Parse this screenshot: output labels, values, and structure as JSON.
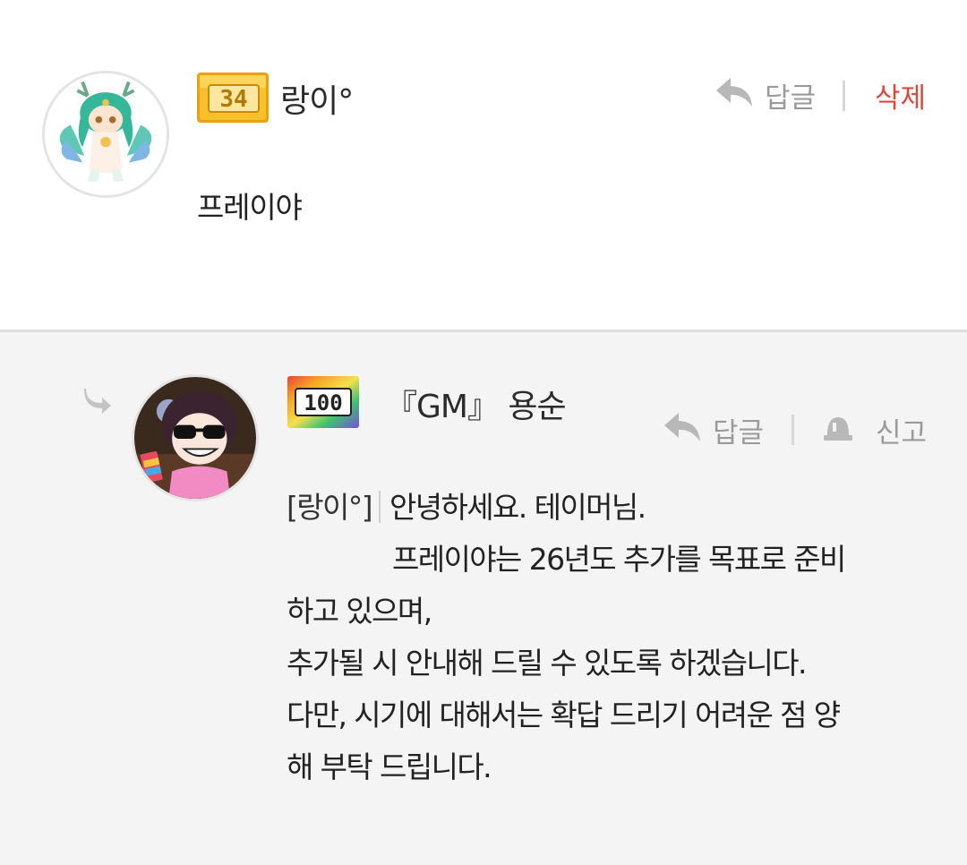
{
  "comment": {
    "level": "34",
    "username": "랑이°",
    "reply_label": "답글",
    "delete_label": "삭제",
    "text": "프레이야"
  },
  "reply": {
    "level": "100",
    "username": "『GM』 용순",
    "reply_label": "답글",
    "report_label": "신고",
    "mention": "[랑이°]",
    "lines": [
      "안녕하세요. 테이머님.",
      "프레이야는 26년도 추가를 목표로 준비",
      "하고 있으며,",
      "추가될 시 안내해 드릴 수 있도록 하겠습니다.",
      "다만, 시기에 대해서는 확답 드리기 어려운 점 양",
      "해 부탁 드립니다."
    ]
  },
  "icons": {
    "reply": "reply-arrow-icon",
    "report": "siren-icon",
    "thread": "thread-reply-icon"
  },
  "colors": {
    "delete": "#d94a3e",
    "action": "#9a9a9a",
    "reply_bg": "#f4f4f4",
    "level_gold": "#f6b81c"
  }
}
